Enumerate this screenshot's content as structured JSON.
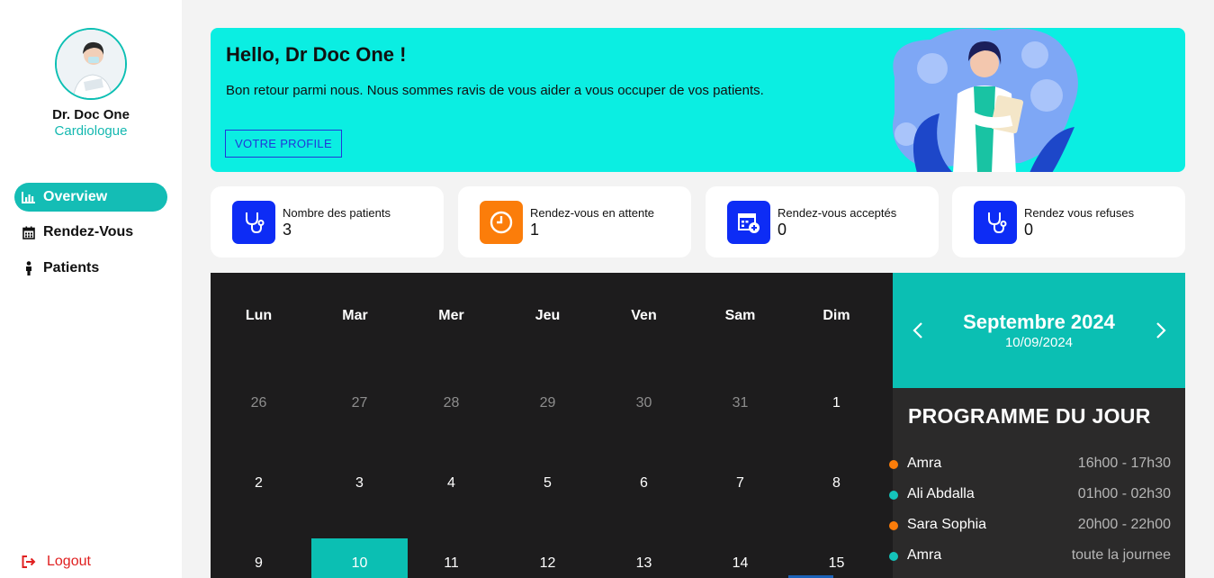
{
  "sidebar": {
    "doctor_name": "Dr. Doc One",
    "specialty": "Cardiologue",
    "nav": [
      {
        "label": "Overview",
        "icon": "bar-chart-icon",
        "active": true
      },
      {
        "label": "Rendez-Vous",
        "icon": "calendar-icon",
        "active": false
      },
      {
        "label": "Patients",
        "icon": "person-icon",
        "active": false
      }
    ],
    "logout_label": "Logout"
  },
  "hero": {
    "title": "Hello, Dr Doc One !",
    "text": "Bon retour parmi nous. Nous sommes ravis de vous aider a vous occuper de vos patients.",
    "button_label": "VOTRE PROFILE"
  },
  "stats": [
    {
      "label": "Nombre des patients",
      "value": "3",
      "icon": "stethoscope-icon",
      "color": "#0d2cf5"
    },
    {
      "label": "Rendez-vous en attente",
      "value": "1",
      "icon": "clock-icon",
      "color": "#fb7d0a"
    },
    {
      "label": "Rendez-vous acceptés",
      "value": "0",
      "icon": "calendar-plus-icon",
      "color": "#0d2cf5"
    },
    {
      "label": "Rendez vous refuses",
      "value": "0",
      "icon": "stethoscope-icon",
      "color": "#0d2cf5"
    }
  ],
  "calendar": {
    "weekdays": [
      "Lun",
      "Mar",
      "Mer",
      "Jeu",
      "Ven",
      "Sam",
      "Dim"
    ],
    "weeks": [
      [
        {
          "d": "26",
          "muted": true
        },
        {
          "d": "27",
          "muted": true
        },
        {
          "d": "28",
          "muted": true
        },
        {
          "d": "29",
          "muted": true
        },
        {
          "d": "30",
          "muted": true
        },
        {
          "d": "31",
          "muted": true
        },
        {
          "d": "1"
        }
      ],
      [
        {
          "d": "2"
        },
        {
          "d": "3"
        },
        {
          "d": "4"
        },
        {
          "d": "5"
        },
        {
          "d": "6"
        },
        {
          "d": "7"
        },
        {
          "d": "8"
        }
      ],
      [
        {
          "d": "9"
        },
        {
          "d": "10",
          "today": true
        },
        {
          "d": "11"
        },
        {
          "d": "12"
        },
        {
          "d": "13"
        },
        {
          "d": "14"
        },
        {
          "d": "15"
        }
      ]
    ],
    "month_title": "Septembre 2024",
    "selected_date": "10/09/2024"
  },
  "programme": {
    "title": "PROGRAMME DU JOUR",
    "items": [
      {
        "name": "Amra",
        "time": "16h00 - 17h30",
        "color": "#fb7d0a"
      },
      {
        "name": "Ali Abdalla",
        "time": "01h00 - 02h30",
        "color": "#14c4bb"
      },
      {
        "name": "Sara Sophia",
        "time": "20h00 - 22h00",
        "color": "#fb7d0a"
      },
      {
        "name": "Amra",
        "time": "toute la journee",
        "color": "#14c4bb"
      }
    ]
  },
  "colors": {
    "accent": "#0bbfb3",
    "hero": "#0beee2",
    "danger": "#e02020"
  }
}
